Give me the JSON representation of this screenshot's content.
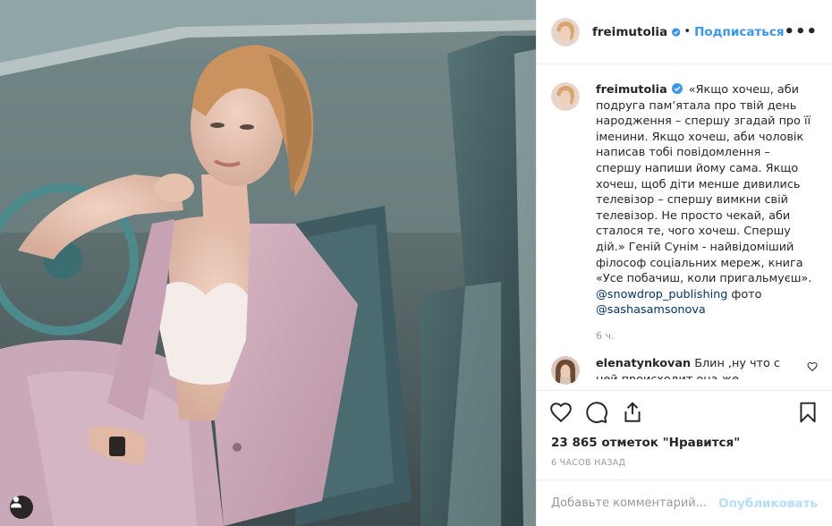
{
  "header": {
    "username": "freimutolia",
    "separator": "•",
    "follow_label": "Подписаться",
    "more_label": "•••"
  },
  "caption": {
    "username": "freimutolia",
    "text": "«Якщо хочеш, аби подруга пам’ятала про твій день народження – спершу згадай про її іменини. Якщо хочеш, аби чоловік написав тобі повідомлення – спершу напиши йому сама. Якщо хочеш, щоб діти менше дивились телевізор – спершу вимкни свій телевізор. Не просто чекай, аби сталося те, чого хочеш. Спершу дій.» Геній Сунім - найвідоміший філософ соціальних мереж, книга «Усе побачиш, коли пригальмуєш».",
    "mention1": "@snowdrop_publishing",
    "mention1_suffix": " фото",
    "mention2": "@sashasamsonova",
    "time": "6 ч."
  },
  "comments": [
    {
      "username": "elenatynkovan",
      "text": "Блин ,ну что с ней происходит,она же"
    }
  ],
  "likes": "23 865 отметок \"Нравится\"",
  "posted": "6 ЧАСОВ НАЗАД",
  "add_comment": {
    "placeholder": "Добавьте комментарий...",
    "publish_label": "Опубликовать"
  },
  "colors": {
    "link": "#3897f0",
    "mention": "#003569",
    "publish_disabled": "#b2dffc"
  },
  "icons": [
    "tagged-user-icon",
    "verified-badge-icon",
    "more-options-icon",
    "heart-icon",
    "comment-icon",
    "share-icon",
    "bookmark-icon",
    "small-heart-icon"
  ]
}
